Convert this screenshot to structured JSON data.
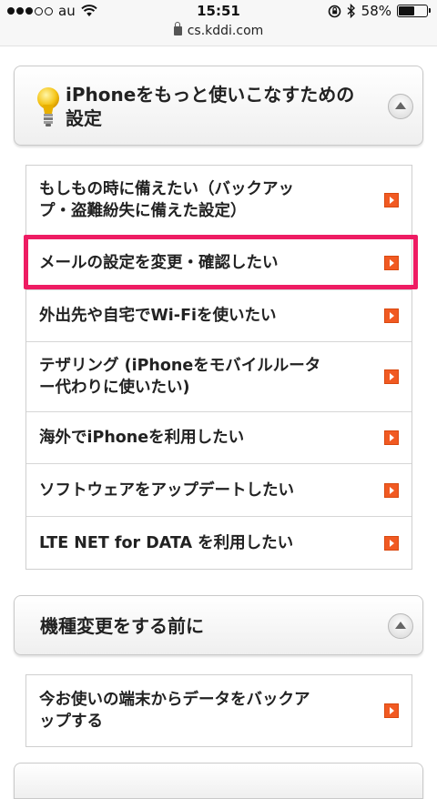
{
  "status_bar": {
    "carrier": "au",
    "time": "15:51",
    "battery_percent": "58%",
    "battery_level": 0.58,
    "signal_bars_filled": 3,
    "signal_bars_total": 5,
    "url": "cs.kddi.com"
  },
  "section1": {
    "title_line1": "iPhoneをもっと使いこなすための",
    "title_line2": "設定",
    "items": [
      {
        "line1": "もしもの時に備えたい（バックアッ",
        "line2": "プ・盗難紛失に備えた設定）"
      },
      {
        "line1": "メールの設定を変更・確認したい",
        "line2": ""
      },
      {
        "line1": "外出先や自宅でWi-Fiを使いたい",
        "line2": ""
      },
      {
        "line1": "テザリング (iPhoneをモバイルルータ",
        "line2": "ー代わりに使いたい)"
      },
      {
        "line1": "海外でiPhoneを利用したい",
        "line2": ""
      },
      {
        "line1": "ソフトウェアをアップデートしたい",
        "line2": ""
      },
      {
        "line1": "LTE NET for DATA を利用したい",
        "line2": ""
      }
    ]
  },
  "section2": {
    "title": "機種変更をする前に",
    "items": [
      {
        "line1": "今お使いの端末からデータをバックア",
        "line2": "ップする"
      }
    ]
  },
  "colors": {
    "arrow": "#f15a22",
    "highlight": "#ee1c63"
  },
  "icons": {
    "section1": "lightbulb-icon",
    "collapse": "collapse-up-icon",
    "item_arrow": "arrow-right-icon"
  }
}
